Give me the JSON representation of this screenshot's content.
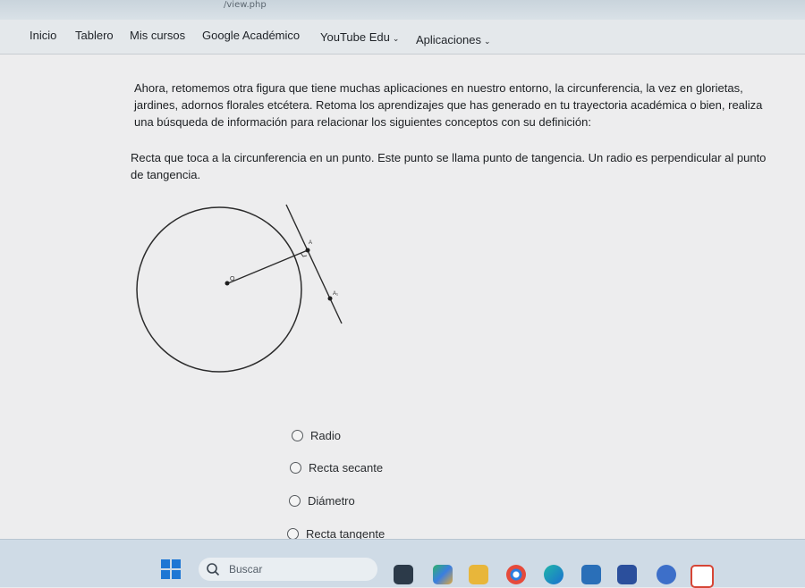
{
  "browser": {
    "url_fragment": "/view.php"
  },
  "nav": {
    "items": [
      "Inicio",
      "Tablero",
      "Mis cursos",
      "Google Académico",
      "YouTube Edu",
      "Aplicaciones"
    ]
  },
  "question": {
    "intro": "Ahora, retomemos otra figura que tiene muchas aplicaciones en nuestro entorno, la circunferencia, la vez en glorietas, jardines, adornos florales etcétera. Retoma los aprendizajes que has generado en tu trayectoria académica o bien, realiza una búsqueda de información para relacionar los siguientes conceptos con su definición:",
    "definition": "Recta que toca a la circunferencia en un punto. Este punto se llama punto de tangencia. Un radio es perpendicular al punto de tangencia.",
    "figure_labels": {
      "center": "O",
      "tangent_point": "A",
      "line_point": "A₁"
    },
    "options": [
      "Radio",
      "Recta secante",
      "Diámetro",
      "Recta tangente"
    ]
  },
  "taskbar": {
    "search_placeholder": "Buscar",
    "icons": [
      "start-icon",
      "search-icon",
      "task-view-icon",
      "copilot-icon",
      "file-explorer-icon",
      "chrome-icon",
      "edge-icon",
      "store-icon",
      "hp-icon",
      "app-icon",
      "gmail-icon"
    ]
  }
}
